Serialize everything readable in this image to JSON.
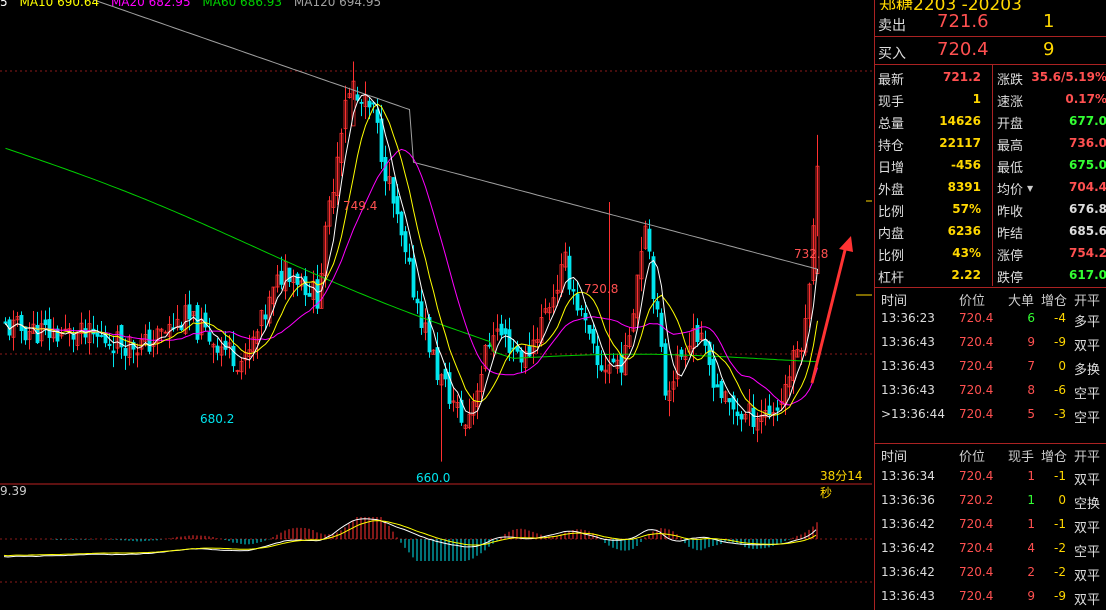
{
  "legend": {
    "ma_prefix": "5",
    "ma10": "MA10 690.64",
    "ma20": "MA20 682.95",
    "ma60": "MA60 686.93",
    "ma120": "MA120 694.95"
  },
  "annotations": {
    "high_label": "749.4",
    "low_label": "660.0",
    "left_low": "680.2",
    "mid_high": "720.8",
    "last_high": "732.8"
  },
  "timer": "38分14秒",
  "macd_label": "9.39",
  "panel": {
    "title_fragment": "郑糖2203 -20203",
    "ask": {
      "label": "卖出",
      "price": "721.6",
      "volume": "1"
    },
    "bid": {
      "label": "买入",
      "price": "720.4",
      "volume": "9"
    },
    "stats": [
      {
        "l1": "最新",
        "v1": "721.2",
        "c1": "red",
        "l2": "涨跌",
        "v2": "35.6/5.19%",
        "c2": "red"
      },
      {
        "l1": "现手",
        "v1": "1",
        "c1": "yel",
        "l2": "速涨",
        "v2": "0.17%",
        "c2": "red"
      },
      {
        "l1": "总量",
        "v1": "14626",
        "c1": "yel",
        "l2": "开盘",
        "v2": "677.0",
        "c2": "grn"
      },
      {
        "l1": "持仓",
        "v1": "22117",
        "c1": "yel",
        "l2": "最高",
        "v2": "736.0",
        "c2": "red"
      },
      {
        "l1": "日增",
        "v1": "-456",
        "c1": "yel",
        "l2": "最低",
        "v2": "675.0",
        "c2": "grn"
      },
      {
        "l1": "外盘",
        "v1": "8391",
        "c1": "yel",
        "l2": "均价",
        "v2": "704.4",
        "c2": "red"
      },
      {
        "l1": "比例",
        "v1": "57%",
        "c1": "yel",
        "l2": "昨收",
        "v2": "676.8",
        "c2": "white"
      },
      {
        "l1": "内盘",
        "v1": "6236",
        "c1": "yel",
        "l2": "昨结",
        "v2": "685.6",
        "c2": "white"
      },
      {
        "l1": "比例",
        "v1": "43%",
        "c1": "yel",
        "l2": "涨停",
        "v2": "754.2",
        "c2": "red"
      },
      {
        "l1": "杠杆",
        "v1": "2.22",
        "c1": "yel",
        "l2": "跌停",
        "v2": "617.0",
        "c2": "grn"
      }
    ],
    "big_head": {
      "time": "时间",
      "price": "价位",
      "vol": "大单",
      "oi": "增仓",
      "type": "开平"
    },
    "big_orders": [
      {
        "time": "13:36:23",
        "price": "720.4",
        "vol": "6",
        "vc": "grn",
        "oi": "-4",
        "type": "多平"
      },
      {
        "time": "13:36:43",
        "price": "720.4",
        "vol": "9",
        "vc": "red",
        "oi": "-9",
        "type": "双平"
      },
      {
        "time": "13:36:43",
        "price": "720.4",
        "vol": "7",
        "vc": "red",
        "oi": "0",
        "type": "多换"
      },
      {
        "time": "13:36:43",
        "price": "720.4",
        "vol": "8",
        "vc": "red",
        "oi": "-6",
        "type": "空平"
      },
      {
        "time": ">13:36:44",
        "price": "720.4",
        "vol": "5",
        "vc": "red",
        "oi": "-3",
        "type": "空平"
      }
    ],
    "tick_head": {
      "time": "时间",
      "price": "价位",
      "vol": "现手",
      "oi": "增仓",
      "type": "开平"
    },
    "ticks": [
      {
        "time": "13:36:34",
        "price": "720.4",
        "vol": "1",
        "vc": "red",
        "oi": "-1",
        "type": "双平"
      },
      {
        "time": "13:36:36",
        "price": "720.2",
        "vol": "1",
        "vc": "grn",
        "oi": "0",
        "type": "空换"
      },
      {
        "time": "13:36:42",
        "price": "720.4",
        "vol": "1",
        "vc": "red",
        "oi": "-1",
        "type": "双平"
      },
      {
        "time": "13:36:42",
        "price": "720.4",
        "vol": "4",
        "vc": "red",
        "oi": "-2",
        "type": "空平"
      },
      {
        "time": "13:36:42",
        "price": "720.4",
        "vol": "2",
        "vc": "red",
        "oi": "-2",
        "type": "双平"
      },
      {
        "time": "13:36:43",
        "price": "720.4",
        "vol": "9",
        "vc": "red",
        "oi": "-9",
        "type": "双平"
      }
    ]
  },
  "colors": {
    "up": "#ff3030",
    "down": "#00e5ee",
    "ma5": "#ffffff",
    "ma10": "#ffff00",
    "ma20": "#ff00ff",
    "ma60": "#00d000",
    "ma120": "#a0a0a0",
    "arrow": "#ff3333",
    "grid": "#8b1a1a"
  },
  "chart_data": {
    "type": "candlestick",
    "ylim": [
      655,
      760
    ],
    "highlights": {
      "max": 749.4,
      "min": 660.0
    },
    "ma120_start": 760,
    "ma60_start": 730
  }
}
